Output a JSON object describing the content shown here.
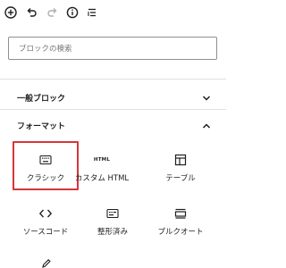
{
  "toolbar": {
    "buttons": [
      {
        "name": "add-block",
        "icon": "plus-circle-icon"
      },
      {
        "name": "undo",
        "icon": "undo-icon"
      },
      {
        "name": "redo",
        "icon": "redo-icon",
        "disabled": true
      },
      {
        "name": "details",
        "icon": "info-icon"
      },
      {
        "name": "list-view",
        "icon": "list-view-icon"
      }
    ]
  },
  "search": {
    "placeholder": "ブロックの検索"
  },
  "panels": [
    {
      "title": "一般ブロック",
      "expanded": false,
      "chevron": "chevron-down-icon"
    },
    {
      "title": "フォーマット",
      "expanded": true,
      "chevron": "chevron-up-icon"
    }
  ],
  "blocks": [
    {
      "label": "クラシック",
      "icon": "keyboard-icon",
      "selected": true
    },
    {
      "label": "カスタム HTML",
      "icon": "html-icon",
      "icon_text": "HTML"
    },
    {
      "label": "テーブル",
      "icon": "table-icon"
    },
    {
      "label": "ソースコード",
      "icon": "code-icon"
    },
    {
      "label": "整形済み",
      "icon": "preformatted-icon"
    },
    {
      "label": "プルクオート",
      "icon": "pullquote-icon"
    },
    {
      "label": "",
      "icon": "pencil-icon"
    }
  ],
  "colors": {
    "selected_border": "#d63638",
    "text": "#1e1e1e",
    "placeholder": "#757575",
    "divider": "#e0e0e0"
  }
}
